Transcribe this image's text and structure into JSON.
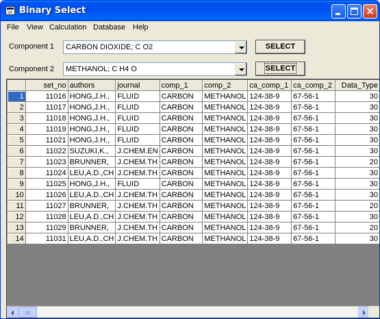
{
  "window": {
    "title": "Binary Select",
    "icon": "app-window-icon"
  },
  "title_buttons": {
    "minimize": "minimize-icon",
    "maximize": "maximize-icon",
    "close": "×"
  },
  "menu": [
    "File",
    "View",
    "Calculation",
    "Database",
    "Help"
  ],
  "component1": {
    "label": "Component 1",
    "value": "CARBON DIOXIDE; C O2",
    "button": "SELECT"
  },
  "component2": {
    "label": "Component 2",
    "value": "METHANOL; C H4 O",
    "button": "SELECT"
  },
  "grid": {
    "columns": [
      "set_no",
      "authors",
      "journal",
      "comp_1",
      "comp_2",
      "ca_comp_1",
      "ca_comp_2",
      "Data_Type"
    ],
    "selected_row": 1,
    "rows": [
      {
        "n": "1",
        "set_no": "11016",
        "authors": "HONG,J.H.,",
        "journal": "FLUID",
        "comp_1": "CARBON",
        "comp_2": "METHANOL",
        "ca1": "124-38-9",
        "ca2": "67-56-1",
        "dt": "30"
      },
      {
        "n": "2",
        "set_no": "11017",
        "authors": "HONG,J.H.,",
        "journal": "FLUID",
        "comp_1": "CARBON",
        "comp_2": "METHANOL",
        "ca1": "124-38-9",
        "ca2": "67-56-1",
        "dt": "30"
      },
      {
        "n": "3",
        "set_no": "11018",
        "authors": "HONG,J.H.,",
        "journal": "FLUID",
        "comp_1": "CARBON",
        "comp_2": "METHANOL",
        "ca1": "124-38-9",
        "ca2": "67-56-1",
        "dt": "30"
      },
      {
        "n": "4",
        "set_no": "11019",
        "authors": "HONG,J.H.,",
        "journal": "FLUID",
        "comp_1": "CARBON",
        "comp_2": "METHANOL",
        "ca1": "124-38-9",
        "ca2": "67-56-1",
        "dt": "30"
      },
      {
        "n": "5",
        "set_no": "11021",
        "authors": "HONG,J.H.,",
        "journal": "FLUID",
        "comp_1": "CARBON",
        "comp_2": "METHANOL",
        "ca1": "124-38-9",
        "ca2": "67-56-1",
        "dt": "30"
      },
      {
        "n": "6",
        "set_no": "11022",
        "authors": "SUZUKI,K.,",
        "journal": "J.CHEM.EN",
        "comp_1": "CARBON",
        "comp_2": "METHANOL",
        "ca1": "124-38-9",
        "ca2": "67-56-1",
        "dt": "30"
      },
      {
        "n": "7",
        "set_no": "11023",
        "authors": "BRUNNER,",
        "journal": "J.CHEM.TH",
        "comp_1": "CARBON",
        "comp_2": "METHANOL",
        "ca1": "124-38-9",
        "ca2": "67-56-1",
        "dt": "20"
      },
      {
        "n": "8",
        "set_no": "11024",
        "authors": "LEU,A.D.,CH",
        "journal": "J.CHEM.TH",
        "comp_1": "CARBON",
        "comp_2": "METHANOL",
        "ca1": "124-38-9",
        "ca2": "67-56-1",
        "dt": "30"
      },
      {
        "n": "9",
        "set_no": "11025",
        "authors": "HONG,J.H.,",
        "journal": "FLUID",
        "comp_1": "CARBON",
        "comp_2": "METHANOL",
        "ca1": "124-38-9",
        "ca2": "67-56-1",
        "dt": "30"
      },
      {
        "n": "10",
        "set_no": "11026",
        "authors": "LEU,A.D.,CH",
        "journal": "J.CHEM.TH",
        "comp_1": "CARBON",
        "comp_2": "METHANOL",
        "ca1": "124-38-9",
        "ca2": "67-56-1",
        "dt": "30"
      },
      {
        "n": "11",
        "set_no": "11027",
        "authors": "BRUNNER,",
        "journal": "J.CHEM.TH",
        "comp_1": "CARBON",
        "comp_2": "METHANOL",
        "ca1": "124-38-9",
        "ca2": "67-56-1",
        "dt": "20"
      },
      {
        "n": "12",
        "set_no": "11028",
        "authors": "LEU,A.D.,CH",
        "journal": "J.CHEM.TH",
        "comp_1": "CARBON",
        "comp_2": "METHANOL",
        "ca1": "124-38-9",
        "ca2": "67-56-1",
        "dt": "30"
      },
      {
        "n": "13",
        "set_no": "11029",
        "authors": "BRUNNER,",
        "journal": "J.CHEM.TH",
        "comp_1": "CARBON",
        "comp_2": "METHANOL",
        "ca1": "124-38-9",
        "ca2": "67-56-1",
        "dt": "20"
      },
      {
        "n": "14",
        "set_no": "11031",
        "authors": "LEU,A.D.,CH",
        "journal": "J.CHEM.TH",
        "comp_1": "CARBON",
        "comp_2": "METHANOL",
        "ca1": "124-38-9",
        "ca2": "67-56-1",
        "dt": "30"
      }
    ]
  },
  "colors": {
    "titlebar": "#0054e3",
    "selected_row_header": "#316ac5",
    "dialog_bg": "#ece9d8"
  }
}
